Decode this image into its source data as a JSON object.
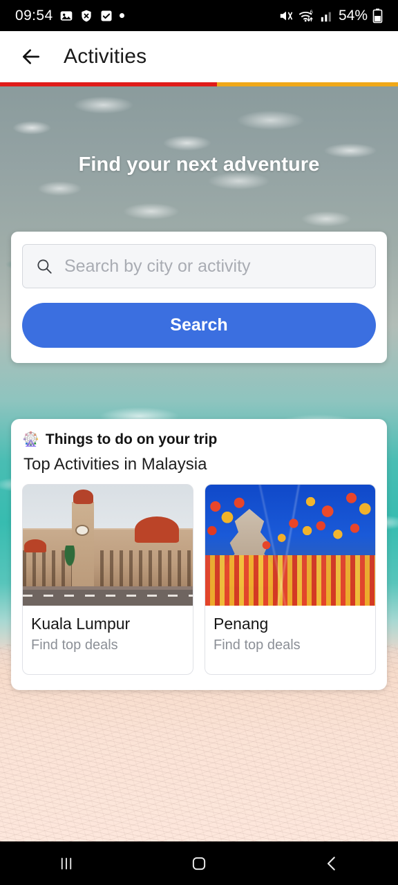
{
  "status_bar": {
    "time": "09:54",
    "battery_percent": "54%",
    "left_icons": [
      "photo-icon",
      "shield-x-icon",
      "checkbox-icon",
      "dot-icon"
    ],
    "right_icons": [
      "mute-icon",
      "wifi-6-icon",
      "cellular-signal-icon",
      "battery-icon"
    ]
  },
  "app_bar": {
    "back_icon": "arrow-left-icon",
    "title": "Activities"
  },
  "accent_stripe": {
    "colors": [
      "#e01b19",
      "#f0a818",
      "#24a45a",
      "#a22fc8",
      "#1485d4"
    ]
  },
  "hero": {
    "title": "Find your next adventure"
  },
  "search": {
    "icon": "search-icon",
    "placeholder": "Search by city or activity",
    "value": "",
    "button_label": "Search",
    "button_color": "#3B6FE0"
  },
  "things_to_do": {
    "icon": "ferris-wheel-icon",
    "icon_glyph": "🎡",
    "heading": "Things to do on your trip",
    "subheading": "Top Activities in Malaysia",
    "cards": [
      {
        "title": "Kuala Lumpur",
        "subtitle": "Find top deals",
        "image_alt": "sultan-abdul-samad-building-photo"
      },
      {
        "title": "Penang",
        "subtitle": "Find top deals",
        "image_alt": "kek-lok-si-temple-lanterns-photo"
      }
    ]
  },
  "nav_bar": {
    "recents_label": "|||",
    "home_label": "▢",
    "back_label": "‹",
    "items": [
      "recents-button",
      "home-button",
      "back-button"
    ]
  }
}
